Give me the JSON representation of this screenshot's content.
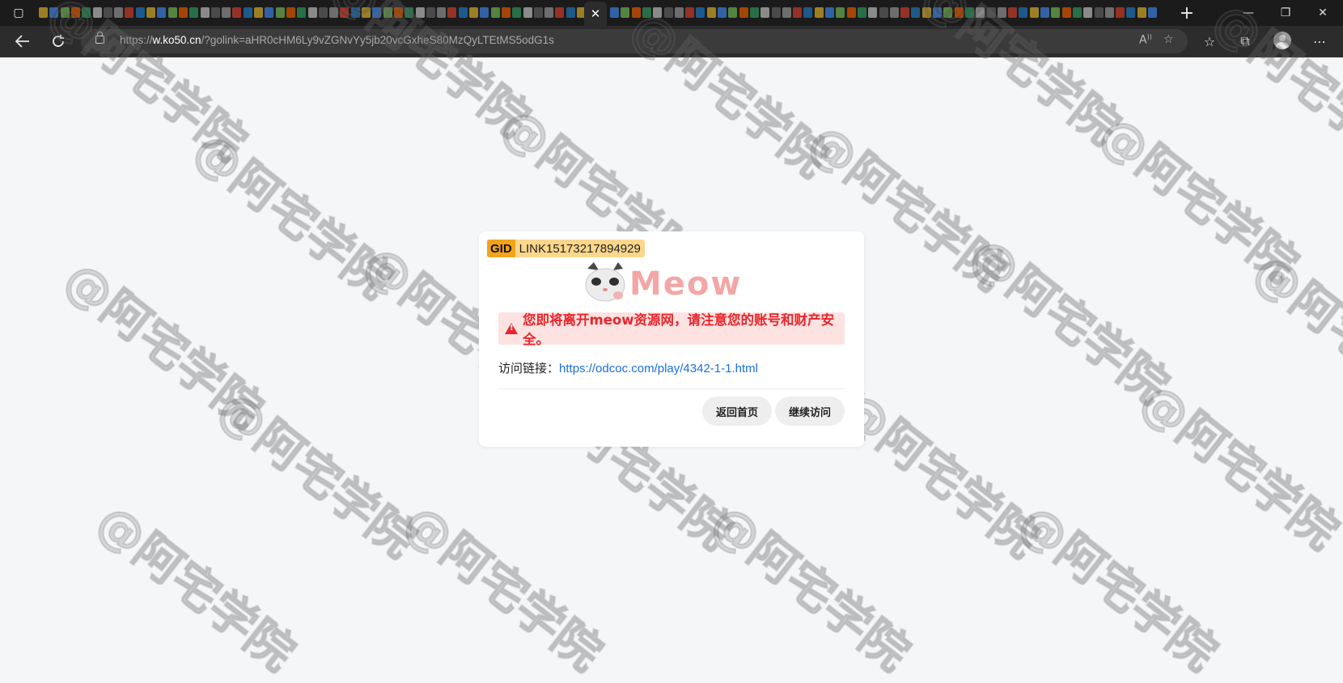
{
  "browser": {
    "close_tab_glyph": "✕",
    "new_tab_glyph": "+",
    "window_controls": {
      "minimize": "—",
      "restore": "❐",
      "close": "✕"
    },
    "address": {
      "prefix": "https://",
      "host": "w.ko50.cn",
      "path": "/?golink=aHR0cHM6Ly9vZGNvYy5jb20vcGxheS80MzQyLTEtMS5odG1s"
    },
    "icons": [
      "sidebar-icon",
      "back-icon",
      "refresh-icon",
      "lock-icon",
      "read-aloud-icon",
      "add-favorite-icon",
      "favorites-icon",
      "collections-icon",
      "profile-icon",
      "more-icon"
    ]
  },
  "watermark": {
    "text": "@阿宅学院"
  },
  "card": {
    "gid_label": "GID",
    "gid_value": "LINK15173217894929",
    "logo_text": "Meow",
    "alert_text": "您即将离开meow资源网，请注意您的账号和财产安全。",
    "link_label": "访问链接：",
    "link_url": "https://odcoc.com/play/4342-1-1.html",
    "home_button": "返回首页",
    "continue_button": "继续访问"
  },
  "colors": {
    "alert_red": "#e8262b",
    "alert_bg": "#fde2e2",
    "link_blue": "#1a6fe0",
    "gid_orange": "#f2a31a",
    "gid_light": "#fbd78c",
    "logo_pink": "#f4a6a6"
  }
}
